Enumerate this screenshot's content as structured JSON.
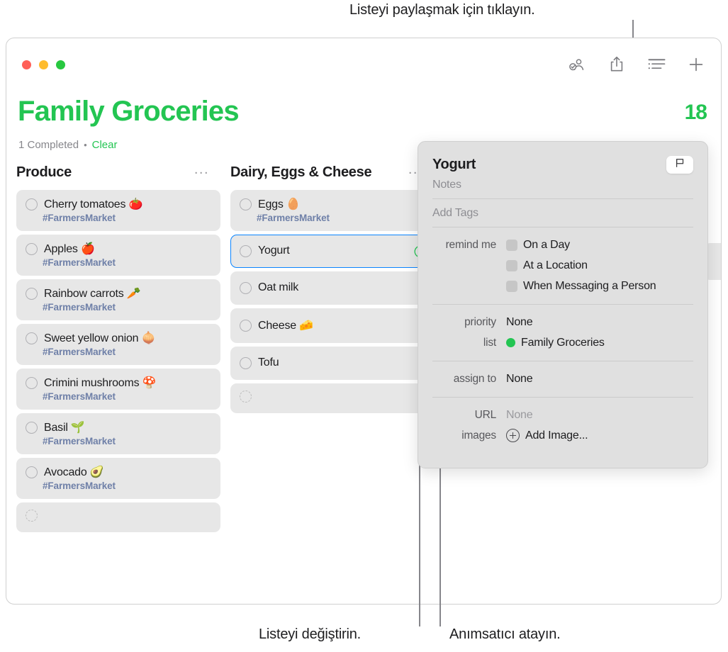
{
  "callouts": {
    "top": "Listeyi paylaşmak için tıklayın.",
    "bottom_left": "Listeyi değiştirin.",
    "bottom_right": "Anımsatıcı atayın."
  },
  "window": {
    "traffic_lights": [
      "close",
      "minimize",
      "zoom"
    ],
    "toolbar_icons": [
      {
        "name": "assigned-reminders-icon",
        "label": "Assigned"
      },
      {
        "name": "share-icon",
        "label": "Share"
      },
      {
        "name": "list-view-icon",
        "label": "View as List"
      },
      {
        "name": "add-reminder-icon",
        "label": "Add"
      }
    ]
  },
  "header": {
    "title": "Family Groceries",
    "title_color": "#23c552",
    "completed_count": "1 Completed",
    "separator": "•",
    "clear_label": "Clear",
    "hidden_count": "18"
  },
  "columns": [
    {
      "title": "Produce",
      "more_label": "...",
      "items": [
        {
          "text": "Cherry tomatoes 🍅",
          "tag": "#FarmersMarket",
          "selected": false,
          "info": false
        },
        {
          "text": "Apples 🍎",
          "tag": "#FarmersMarket",
          "selected": false,
          "info": false
        },
        {
          "text": "Rainbow carrots 🥕",
          "tag": "#FarmersMarket",
          "selected": false,
          "info": false
        },
        {
          "text": "Sweet yellow onion 🧅",
          "tag": "#FarmersMarket",
          "selected": false,
          "info": false
        },
        {
          "text": "Crimini mushrooms 🍄",
          "tag": "#FarmersMarket",
          "selected": false,
          "info": false
        },
        {
          "text": "Basil 🌱",
          "tag": "#FarmersMarket",
          "selected": false,
          "info": false
        },
        {
          "text": "Avocado 🥑",
          "tag": "#FarmersMarket",
          "selected": false,
          "info": false
        },
        {
          "text": "",
          "tag": "",
          "selected": false,
          "info": false,
          "empty": true
        }
      ]
    },
    {
      "title": "Dairy, Eggs & Cheese",
      "more_label": "...",
      "items": [
        {
          "text": "Eggs 🥚",
          "tag": "#FarmersMarket",
          "selected": false,
          "info": false
        },
        {
          "text": "Yogurt",
          "tag": "",
          "selected": true,
          "info": true
        },
        {
          "text": "Oat milk",
          "tag": "",
          "selected": false,
          "info": false
        },
        {
          "text": "Cheese 🧀",
          "tag": "",
          "selected": false,
          "info": false
        },
        {
          "text": "Tofu",
          "tag": "",
          "selected": false,
          "info": false
        },
        {
          "text": "",
          "tag": "",
          "selected": false,
          "info": false,
          "empty": true
        }
      ]
    }
  ],
  "popover": {
    "title": "Yogurt",
    "flag_icon": "flag-icon",
    "notes_placeholder": "Notes",
    "tags_placeholder": "Add Tags",
    "remind_me_label": "remind me",
    "remind_options": [
      "On a Day",
      "At a Location",
      "When Messaging a Person"
    ],
    "priority_label": "priority",
    "priority_value": "None",
    "list_label": "list",
    "list_value": "Family Groceries",
    "list_color": "#23c552",
    "assign_label": "assign to",
    "assign_value": "None",
    "url_label": "URL",
    "url_value": "None",
    "images_label": "images",
    "images_value": "Add Image..."
  }
}
